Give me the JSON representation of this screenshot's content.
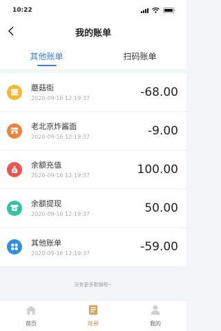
{
  "status_bar": {
    "time": "10:22"
  },
  "header": {
    "title": "我的账单"
  },
  "tabs": [
    {
      "label": "其他账单",
      "active": true
    },
    {
      "label": "扫码账单",
      "active": false
    }
  ],
  "bills": [
    {
      "name": "蘑菇街",
      "time": "2020-09-16 12:19:37",
      "amount": "-68.00",
      "icon": "wallet-icon",
      "color": "#f7b731"
    },
    {
      "name": "老北京炸酱面",
      "time": "2020-09-16 12:19:37",
      "amount": "-9.00",
      "icon": "shop-icon",
      "color": "#f0803a"
    },
    {
      "name": "余额充值",
      "time": "2020-09-16 12:19:37",
      "amount": "100.00",
      "icon": "money-bag-icon",
      "color": "#ef5350"
    },
    {
      "name": "余额提现",
      "time": "2020-09-16 12:19:37",
      "amount": "50.00",
      "icon": "withdraw-icon",
      "color": "#2ec4a0"
    },
    {
      "name": "其他账单",
      "time": "2020-09-16 12:19:37",
      "amount": "-59.00",
      "icon": "grid-icon",
      "color": "#2f8fe0"
    }
  ],
  "no_more_text": "没有更多数据啦~",
  "tab_bar": [
    {
      "label": "首页",
      "icon": "home-icon",
      "active": false
    },
    {
      "label": "账单",
      "icon": "bill-icon",
      "active": true
    },
    {
      "label": "我的",
      "icon": "user-icon",
      "active": false
    }
  ],
  "colors": {
    "accent": "#3a7fd5",
    "tab_bar_active": "#c49652"
  }
}
